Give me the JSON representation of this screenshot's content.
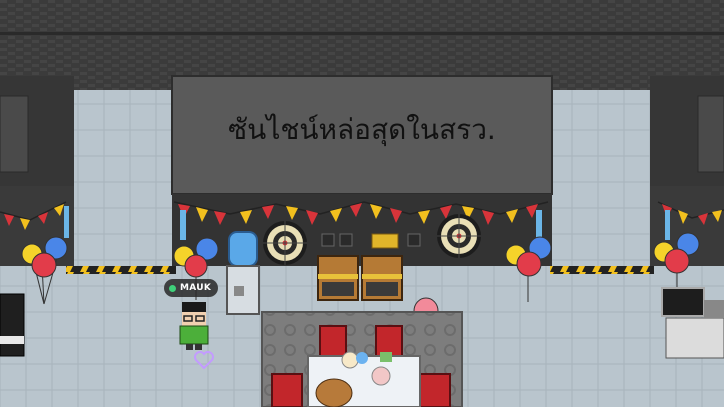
{
  "sign": {
    "text": "ซันไชน์หล่อสุดในสรว."
  },
  "player": {
    "name": "MAUK",
    "status_color": "#3fd07a"
  },
  "colors": {
    "wall_dark": "#3a3a3a",
    "wall_panel": "#5a5a5a",
    "floor": "#b8c4cc",
    "flag_red": "#d8343a",
    "flag_yellow": "#f2c01e",
    "balloon_red": "#e23c4a",
    "balloon_blue": "#4a86e8",
    "balloon_yellow": "#f5d32a"
  }
}
